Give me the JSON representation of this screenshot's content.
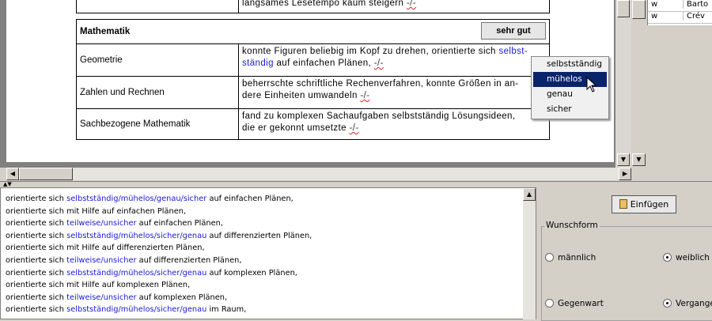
{
  "report": {
    "top_fragment": "langsames Lesetempo kaum steigern",
    "top_marker": "-/-",
    "section_title": "Mathematik",
    "grade": "sehr gut",
    "rows": [
      {
        "subject": "Geometrie",
        "pre": "konnte Figuren beliebig im Kopf zu drehen, orientierte sich ",
        "highlight": "selbst-",
        "line2_highlight": "ständig",
        "line2_rest": " auf einfachen Plänen, ",
        "marker": "-/-"
      },
      {
        "subject": "Zahlen und Rechnen",
        "line1": "beherrschte schriftliche Rechenverfahren, konnte Größen in an-",
        "line2": "dere Einheiten umwandeln ",
        "marker": "-/-"
      },
      {
        "subject": "Sachbezogene Mathematik",
        "line1": "fand zu komplexen Sachaufgaben selbstständig Lösungsideen,",
        "line2": "die er gekonnt umsetzte ",
        "marker": "-/-"
      }
    ]
  },
  "names_list": [
    {
      "col1": "w",
      "col2": "Barto"
    },
    {
      "col1": "w",
      "col2": "Crév"
    }
  ],
  "popup": {
    "items": [
      "selbstständig",
      "mühelos",
      "genau",
      "sicher"
    ],
    "selected": "mühelos"
  },
  "text_lines": [
    {
      "pre": "orientierte sich ",
      "blue": "selbstständig/mühelos/genau/sicher",
      "post": " auf einfachen Plänen,"
    },
    {
      "pre": "orientierte sich mit Hilfe auf einfachen Plänen,",
      "blue": "",
      "post": ""
    },
    {
      "pre": "orientierte sich ",
      "blue": "teilweise/unsicher",
      "post": " auf einfachen Plänen,"
    },
    {
      "pre": "orientierte sich ",
      "blue": "selbstständig/mühelos/sicher/genau",
      "post": " auf differenzierten Plänen,"
    },
    {
      "pre": "orientierte sich mit Hilfe auf differenzierten Plänen,",
      "blue": "",
      "post": ""
    },
    {
      "pre": "orientierte sich ",
      "blue": "teilweise/unsicher",
      "post": " auf differenzierten Plänen,"
    },
    {
      "pre": "orientierte sich ",
      "blue": "selbstständig/mühelos/sicher/genau",
      "post": " auf komplexen Plänen,"
    },
    {
      "pre": "orientierte sich mit Hilfe auf komplexen Plänen,",
      "blue": "",
      "post": ""
    },
    {
      "pre": "orientierte sich ",
      "blue": "teilweise/unsicher",
      "post": " auf komplexen Plänen,"
    },
    {
      "pre": "orientierte sich ",
      "blue": "selbstständig/mühelos/sicher/genau",
      "post": " im Raum,"
    }
  ],
  "right_panel": {
    "insert_label": "Einfügen",
    "group_label": "Wunschform",
    "radios": [
      {
        "label": "männlich",
        "checked": false
      },
      {
        "label": "weiblich",
        "checked": true
      },
      {
        "label": "Gegenwart",
        "checked": false
      },
      {
        "label": "Vergangenheit",
        "checked": true
      }
    ]
  },
  "colors": {
    "highlight": "#1a1ad8",
    "selection": "#0a246a"
  }
}
